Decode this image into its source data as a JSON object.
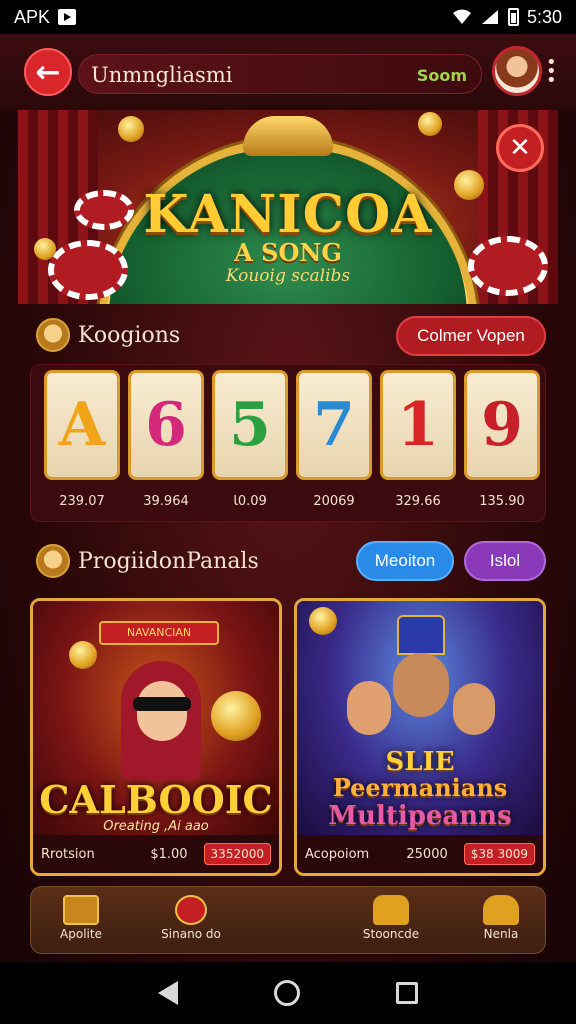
{
  "status_bar": {
    "left_label": "APK",
    "time": "5:30"
  },
  "header": {
    "title": "Unmngliasmi",
    "coins": "Soom"
  },
  "hero": {
    "logo": "KANICOA",
    "line1": "A SONG",
    "line2": "Kouoig scalibs"
  },
  "slots_section": {
    "title": "Koogions",
    "button": "Colmer Vopen",
    "reels": [
      {
        "symbol": "A",
        "value": "239.07",
        "color": "#f2a418"
      },
      {
        "symbol": "6",
        "value": "39.964",
        "color": "#d4287a"
      },
      {
        "symbol": "5",
        "value": "Ɩ0.09",
        "color": "#2aa040"
      },
      {
        "symbol": "7",
        "value": "20069",
        "color": "#2a8ad0"
      },
      {
        "symbol": "1",
        "value": "329.66",
        "color": "#d82424"
      },
      {
        "symbol": "9",
        "value": "135.90",
        "color": "#c8202a"
      }
    ]
  },
  "promo_section": {
    "title": "ProgiidonPanals",
    "tab_primary": "Meoiton",
    "tab_secondary": "Islol",
    "cards": [
      {
        "tag": "NAVANCIAN",
        "headline": "CALBOOIC",
        "subline": "Oreating ,Ai aao",
        "foot_label": "Rrotsion",
        "price": "$1.00",
        "badge": "3352000"
      },
      {
        "tag": "",
        "headline": "SLIE",
        "headline2": "Peermanians",
        "headline3": "Multipeanns",
        "subline": "",
        "foot_label": "Acopoiom",
        "price": "25000",
        "badge": "$38 3009"
      }
    ]
  },
  "bottom_nav": [
    {
      "label": "Apolite",
      "icon": "gift-box-icon"
    },
    {
      "label": "Sinano do",
      "icon": "wand-icon"
    },
    {
      "label": "Stooncde",
      "icon": "crown-sofa-icon"
    },
    {
      "label": "Nenla",
      "icon": "crown-icon"
    }
  ],
  "colors": {
    "accent_red": "#d8262b",
    "gold": "#e5b23a",
    "blue_tab": "#2a8ae8",
    "purple_tab": "#8a3ab8"
  }
}
